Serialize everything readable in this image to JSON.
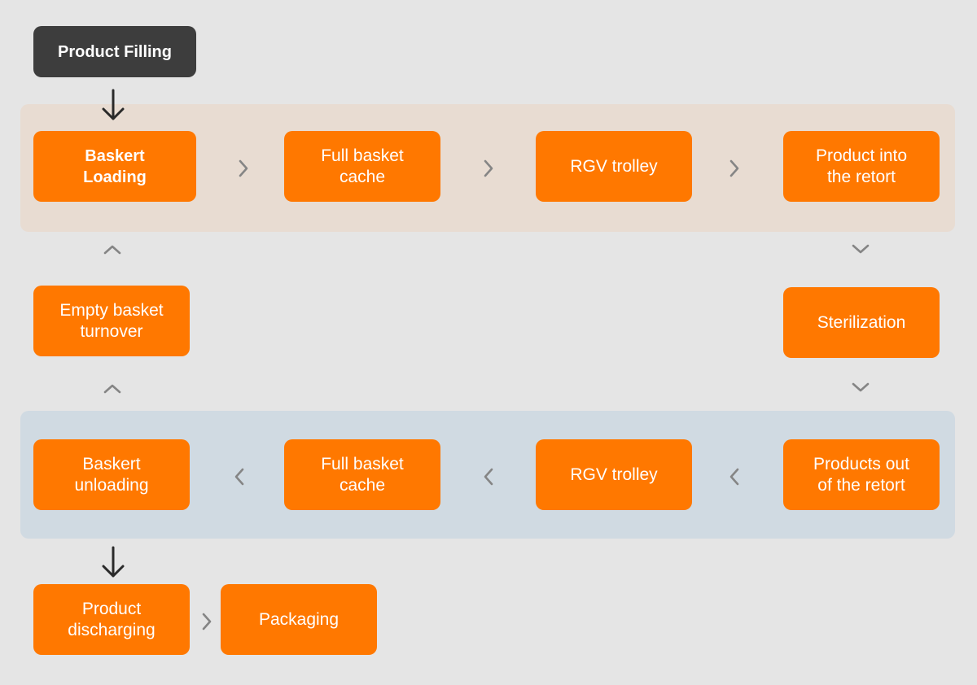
{
  "colors": {
    "background": "#e5e5e5",
    "step_fill": "#ff7800",
    "start_fill": "#3d3d3d",
    "loading_band": "#e8dcd2",
    "unloading_band": "#d0dae2",
    "connector": "#858585"
  },
  "diagram": {
    "start": {
      "label": "Product Filling"
    },
    "loading_row": [
      {
        "label": "Baskert\nLoading"
      },
      {
        "label": "Full basket\ncache"
      },
      {
        "label": "RGV trolley"
      },
      {
        "label": "Product into\nthe retort"
      }
    ],
    "sterilization": {
      "label": "Sterilization"
    },
    "unloading_row": [
      {
        "label": "Products out\nof the retort"
      },
      {
        "label": "RGV trolley"
      },
      {
        "label": "Full basket\ncache"
      },
      {
        "label": "Baskert\nunloading"
      }
    ],
    "return": {
      "label": "Empty basket\nturnover"
    },
    "output_row": [
      {
        "label": "Product\ndischarging"
      },
      {
        "label": "Packaging"
      }
    ],
    "connectors": {
      "start_to_loading": "arrow-down-icon",
      "loading_flow": "chevron-right-icon",
      "retort_to_sterilization": "chevron-down-icon",
      "unloading_flow": "chevron-left-icon",
      "return_flow": "chevron-up-icon",
      "unloading_to_discharge": "arrow-down-icon",
      "discharge_to_packaging": "chevron-right-icon"
    }
  }
}
